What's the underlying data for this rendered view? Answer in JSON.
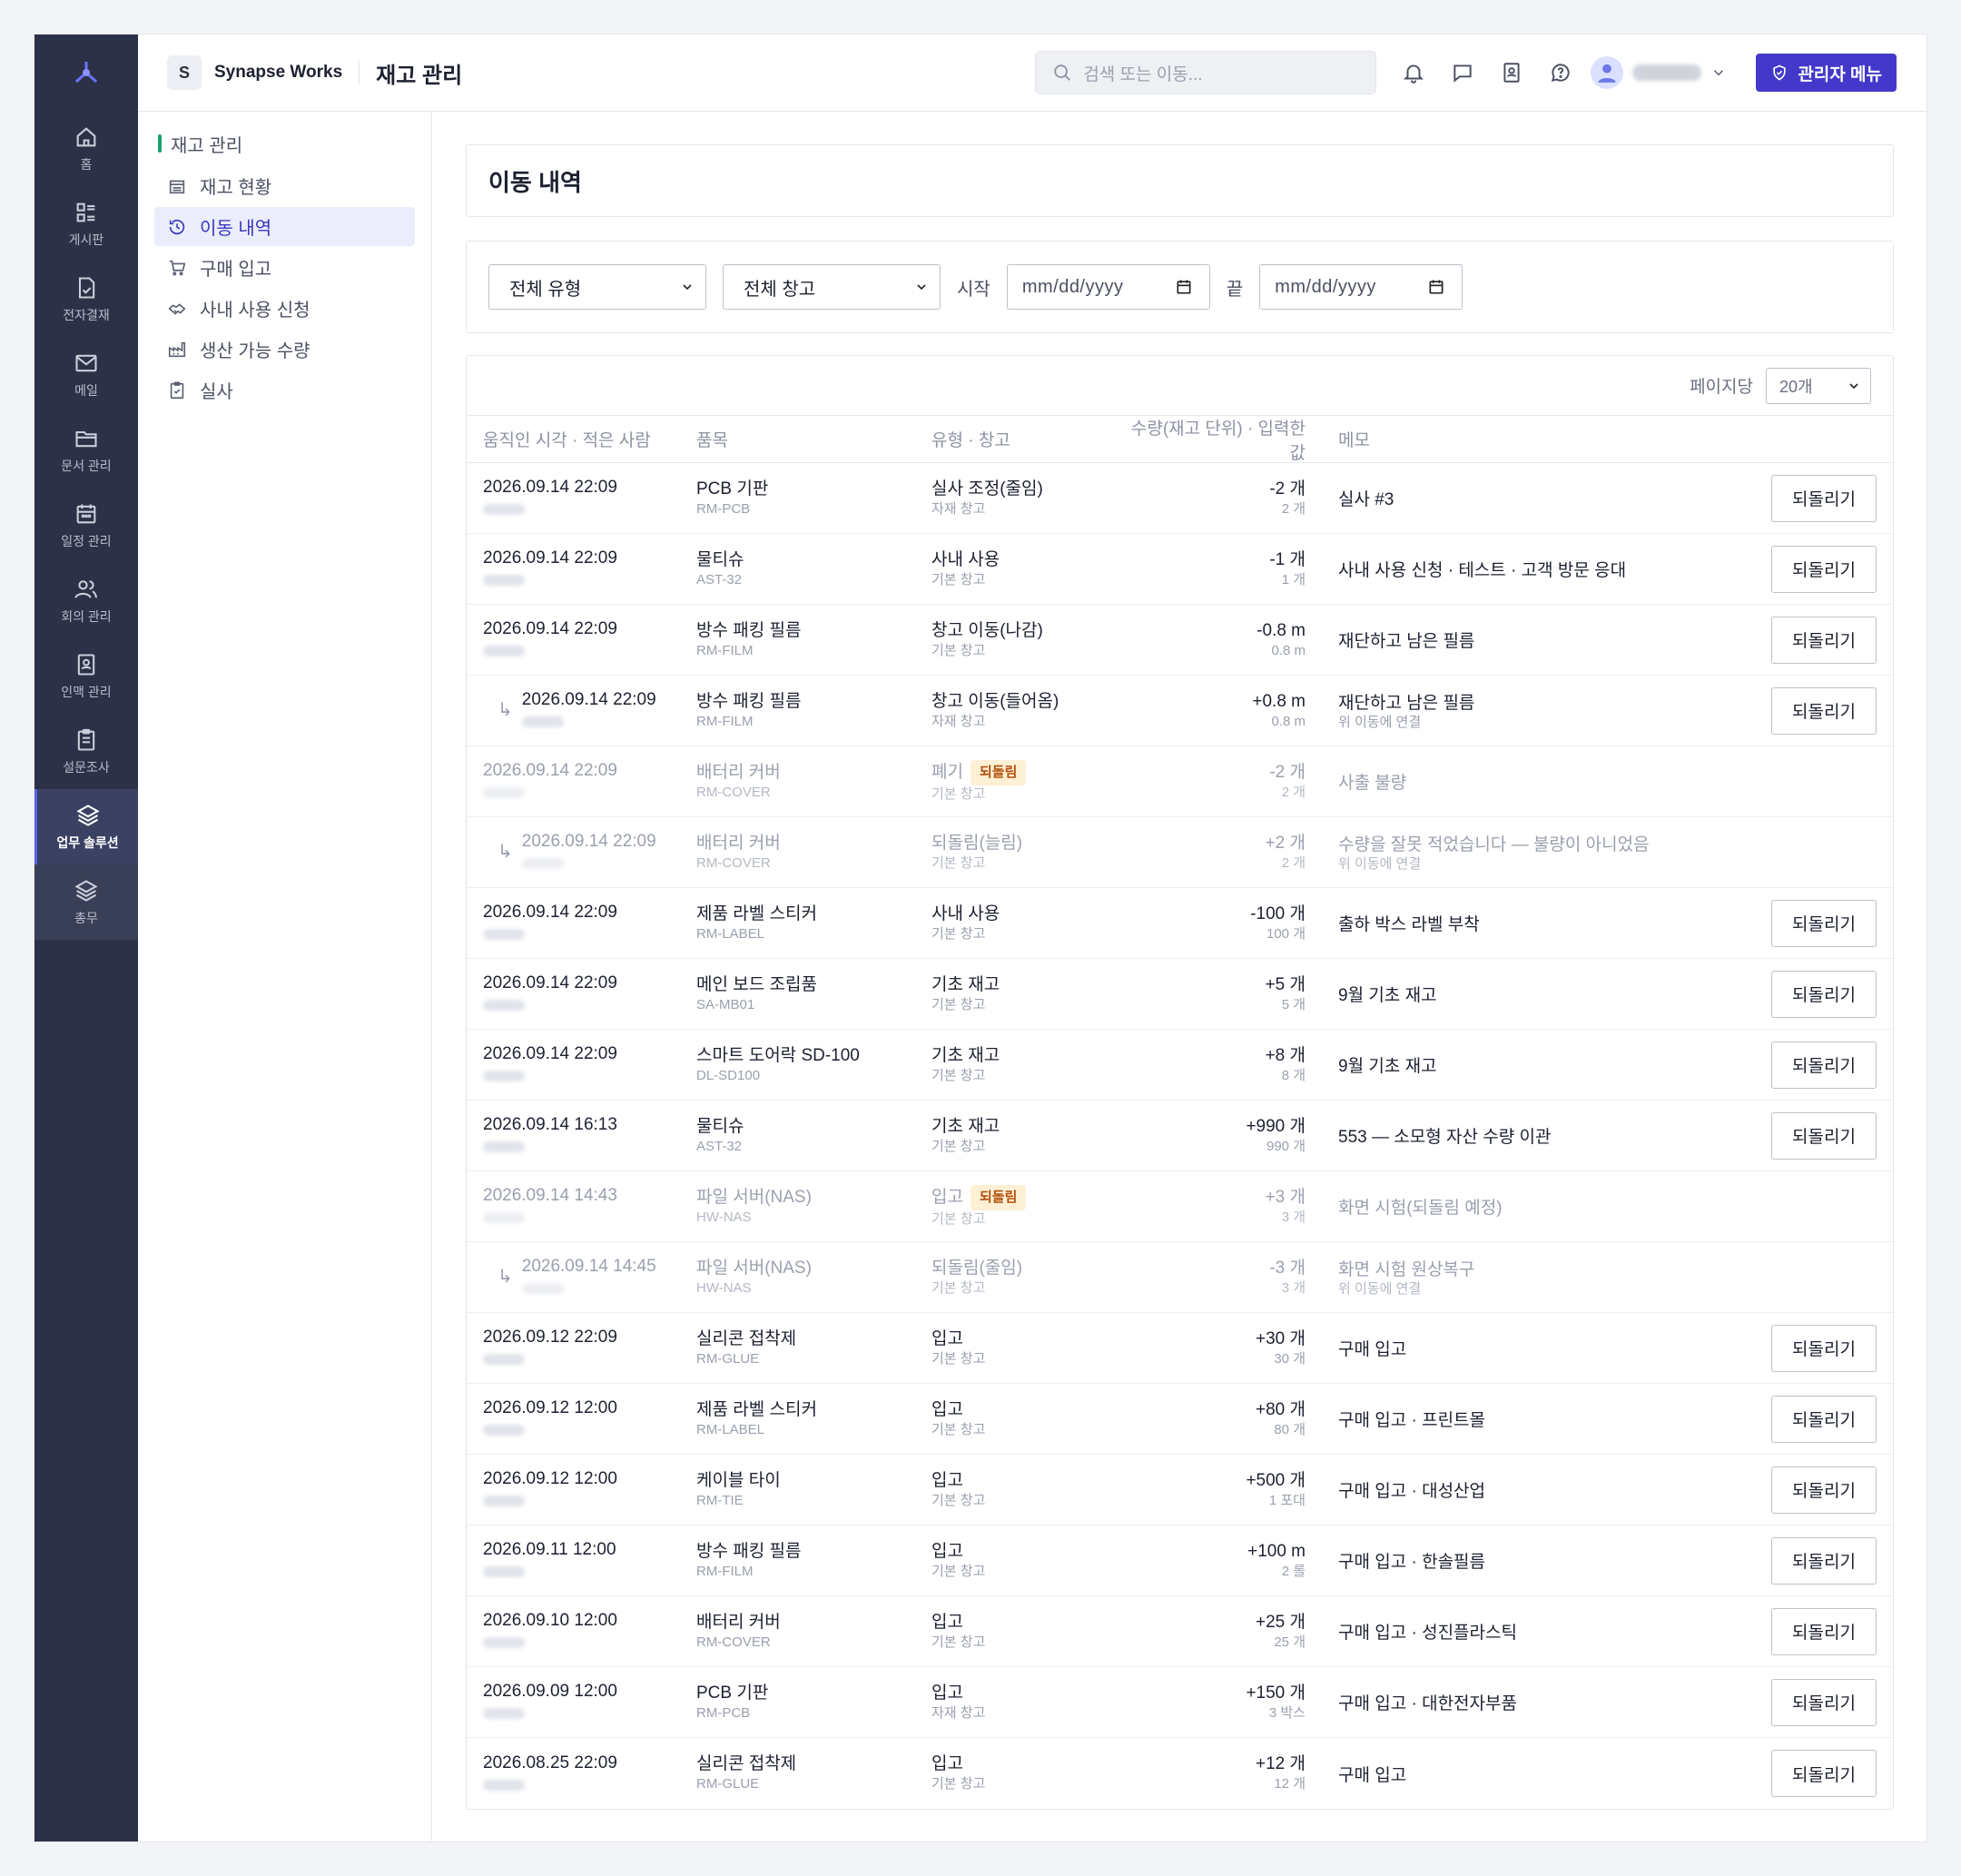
{
  "topbar": {
    "workspace_badge": "S",
    "workspace_name": "Synapse Works",
    "page_title": "재고 관리",
    "search_placeholder": "검색 또는 이동...",
    "admin_label": "관리자 메뉴"
  },
  "rail": {
    "items": [
      {
        "label": "홈",
        "icon": "home-icon"
      },
      {
        "label": "게시판",
        "icon": "board-icon"
      },
      {
        "label": "전자결재",
        "icon": "approval-icon"
      },
      {
        "label": "메일",
        "icon": "mail-icon"
      },
      {
        "label": "문서 관리",
        "icon": "folder-icon"
      },
      {
        "label": "일정 관리",
        "icon": "calendar-icon"
      },
      {
        "label": "회의 관리",
        "icon": "people-icon"
      },
      {
        "label": "인맥 관리",
        "icon": "contact-icon"
      },
      {
        "label": "설문조사",
        "icon": "survey-icon"
      },
      {
        "label": "업무 솔루션",
        "icon": "layers-icon"
      },
      {
        "label": "총무",
        "icon": "layers-icon"
      }
    ]
  },
  "subnav": {
    "heading": "재고 관리",
    "items": [
      {
        "label": "재고 현황",
        "icon": "inventory-icon"
      },
      {
        "label": "이동 내역",
        "icon": "history-icon"
      },
      {
        "label": "구매 입고",
        "icon": "cart-icon"
      },
      {
        "label": "사내 사용 신청",
        "icon": "handshake-icon"
      },
      {
        "label": "생산 가능 수량",
        "icon": "factory-icon"
      },
      {
        "label": "실사",
        "icon": "clipboard-icon"
      }
    ]
  },
  "content": {
    "title": "이동 내역",
    "filters": {
      "type_select": "전체 유형",
      "warehouse_select": "전체 창고",
      "start_label": "시작",
      "start_placeholder": "mm/dd/yyyy",
      "end_label": "끝",
      "end_placeholder": "mm/dd/yyyy"
    },
    "per_page_label": "페이지당",
    "per_page_value": "20개",
    "columns": {
      "time": "움직인 시각 · 적은 사람",
      "item": "품목",
      "type": "유형 · 창고",
      "qty": "수량(재고 단위) · 입력한 값",
      "memo": "메모"
    },
    "revert_label": "되돌리기",
    "reverted_badge": "되돌림",
    "rows": [
      {
        "time": "2026.09.14 22:09",
        "item": "PCB 기판",
        "code": "RM-PCB",
        "type": "실사 조정(줄임)",
        "warehouse": "자재 창고",
        "qty": "-2 개",
        "input": "2 개",
        "memo": "실사 #3",
        "memo_sub": "",
        "child": false,
        "dim": false,
        "badge": false,
        "revert": true
      },
      {
        "time": "2026.09.14 22:09",
        "item": "물티슈",
        "code": "AST-32",
        "type": "사내 사용",
        "warehouse": "기본 창고",
        "qty": "-1 개",
        "input": "1 개",
        "memo": "사내 사용 신청 · 테스트 · 고객 방문 응대",
        "memo_sub": "",
        "child": false,
        "dim": false,
        "badge": false,
        "revert": true
      },
      {
        "time": "2026.09.14 22:09",
        "item": "방수 패킹 필름",
        "code": "RM-FILM",
        "type": "창고 이동(나감)",
        "warehouse": "기본 창고",
        "qty": "-0.8 m",
        "input": "0.8 m",
        "memo": "재단하고 남은 필름",
        "memo_sub": "",
        "child": false,
        "dim": false,
        "badge": false,
        "revert": true
      },
      {
        "time": "2026.09.14 22:09",
        "item": "방수 패킹 필름",
        "code": "RM-FILM",
        "type": "창고 이동(들어옴)",
        "warehouse": "자재 창고",
        "qty": "+0.8 m",
        "input": "0.8 m",
        "memo": "재단하고 남은 필름",
        "memo_sub": "위 이동에 연결",
        "child": true,
        "dim": false,
        "badge": false,
        "revert": true
      },
      {
        "time": "2026.09.14 22:09",
        "item": "배터리 커버",
        "code": "RM-COVER",
        "type": "폐기",
        "warehouse": "기본 창고",
        "qty": "-2 개",
        "input": "2 개",
        "memo": "사출 불량",
        "memo_sub": "",
        "child": false,
        "dim": true,
        "badge": true,
        "revert": false
      },
      {
        "time": "2026.09.14 22:09",
        "item": "배터리 커버",
        "code": "RM-COVER",
        "type": "되돌림(늘림)",
        "warehouse": "기본 창고",
        "qty": "+2 개",
        "input": "2 개",
        "memo": "수량을 잘못 적었습니다 — 불량이 아니었음",
        "memo_sub": "위 이동에 연결",
        "child": true,
        "dim": true,
        "badge": false,
        "revert": false
      },
      {
        "time": "2026.09.14 22:09",
        "item": "제품 라벨 스티커",
        "code": "RM-LABEL",
        "type": "사내 사용",
        "warehouse": "기본 창고",
        "qty": "-100 개",
        "input": "100 개",
        "memo": "출하 박스 라벨 부착",
        "memo_sub": "",
        "child": false,
        "dim": false,
        "badge": false,
        "revert": true
      },
      {
        "time": "2026.09.14 22:09",
        "item": "메인 보드 조립품",
        "code": "SA-MB01",
        "type": "기초 재고",
        "warehouse": "기본 창고",
        "qty": "+5 개",
        "input": "5 개",
        "memo": "9월 기초 재고",
        "memo_sub": "",
        "child": false,
        "dim": false,
        "badge": false,
        "revert": true
      },
      {
        "time": "2026.09.14 22:09",
        "item": "스마트 도어락 SD-100",
        "code": "DL-SD100",
        "type": "기초 재고",
        "warehouse": "기본 창고",
        "qty": "+8 개",
        "input": "8 개",
        "memo": "9월 기초 재고",
        "memo_sub": "",
        "child": false,
        "dim": false,
        "badge": false,
        "revert": true
      },
      {
        "time": "2026.09.14 16:13",
        "item": "물티슈",
        "code": "AST-32",
        "type": "기초 재고",
        "warehouse": "기본 창고",
        "qty": "+990 개",
        "input": "990 개",
        "memo": "553 — 소모형 자산 수량 이관",
        "memo_sub": "",
        "child": false,
        "dim": false,
        "badge": false,
        "revert": true
      },
      {
        "time": "2026.09.14 14:43",
        "item": "파일 서버(NAS)",
        "code": "HW-NAS",
        "type": "입고",
        "warehouse": "기본 창고",
        "qty": "+3 개",
        "input": "3 개",
        "memo": "화면 시험(되돌림 예정)",
        "memo_sub": "",
        "child": false,
        "dim": true,
        "badge": true,
        "revert": false
      },
      {
        "time": "2026.09.14 14:45",
        "item": "파일 서버(NAS)",
        "code": "HW-NAS",
        "type": "되돌림(줄임)",
        "warehouse": "기본 창고",
        "qty": "-3 개",
        "input": "3 개",
        "memo": "화면 시험 원상복구",
        "memo_sub": "위 이동에 연결",
        "child": true,
        "dim": true,
        "badge": false,
        "revert": false
      },
      {
        "time": "2026.09.12 22:09",
        "item": "실리콘 접착제",
        "code": "RM-GLUE",
        "type": "입고",
        "warehouse": "기본 창고",
        "qty": "+30 개",
        "input": "30 개",
        "memo": "구매 입고",
        "memo_sub": "",
        "child": false,
        "dim": false,
        "badge": false,
        "revert": true
      },
      {
        "time": "2026.09.12 12:00",
        "item": "제품 라벨 스티커",
        "code": "RM-LABEL",
        "type": "입고",
        "warehouse": "기본 창고",
        "qty": "+80 개",
        "input": "80 개",
        "memo": "구매 입고 · 프린트몰",
        "memo_sub": "",
        "child": false,
        "dim": false,
        "badge": false,
        "revert": true
      },
      {
        "time": "2026.09.12 12:00",
        "item": "케이블 타이",
        "code": "RM-TIE",
        "type": "입고",
        "warehouse": "기본 창고",
        "qty": "+500 개",
        "input": "1 포대",
        "memo": "구매 입고 · 대성산업",
        "memo_sub": "",
        "child": false,
        "dim": false,
        "badge": false,
        "revert": true
      },
      {
        "time": "2026.09.11 12:00",
        "item": "방수 패킹 필름",
        "code": "RM-FILM",
        "type": "입고",
        "warehouse": "기본 창고",
        "qty": "+100 m",
        "input": "2 롤",
        "memo": "구매 입고 · 한솔필름",
        "memo_sub": "",
        "child": false,
        "dim": false,
        "badge": false,
        "revert": true
      },
      {
        "time": "2026.09.10 12:00",
        "item": "배터리 커버",
        "code": "RM-COVER",
        "type": "입고",
        "warehouse": "기본 창고",
        "qty": "+25 개",
        "input": "25 개",
        "memo": "구매 입고 · 성진플라스틱",
        "memo_sub": "",
        "child": false,
        "dim": false,
        "badge": false,
        "revert": true
      },
      {
        "time": "2026.09.09 12:00",
        "item": "PCB 기판",
        "code": "RM-PCB",
        "type": "입고",
        "warehouse": "자재 창고",
        "qty": "+150 개",
        "input": "3 박스",
        "memo": "구매 입고 · 대한전자부품",
        "memo_sub": "",
        "child": false,
        "dim": false,
        "badge": false,
        "revert": true
      },
      {
        "time": "2026.08.25 22:09",
        "item": "실리콘 접착제",
        "code": "RM-GLUE",
        "type": "입고",
        "warehouse": "기본 창고",
        "qty": "+12 개",
        "input": "12 개",
        "memo": "구매 입고",
        "memo_sub": "",
        "child": false,
        "dim": false,
        "badge": false,
        "revert": true
      }
    ]
  },
  "colors": {
    "rail_bg": "#2c3147",
    "accent": "#4338ca",
    "badge_bg": "#fdf0d5",
    "badge_text": "#b24e0b"
  }
}
